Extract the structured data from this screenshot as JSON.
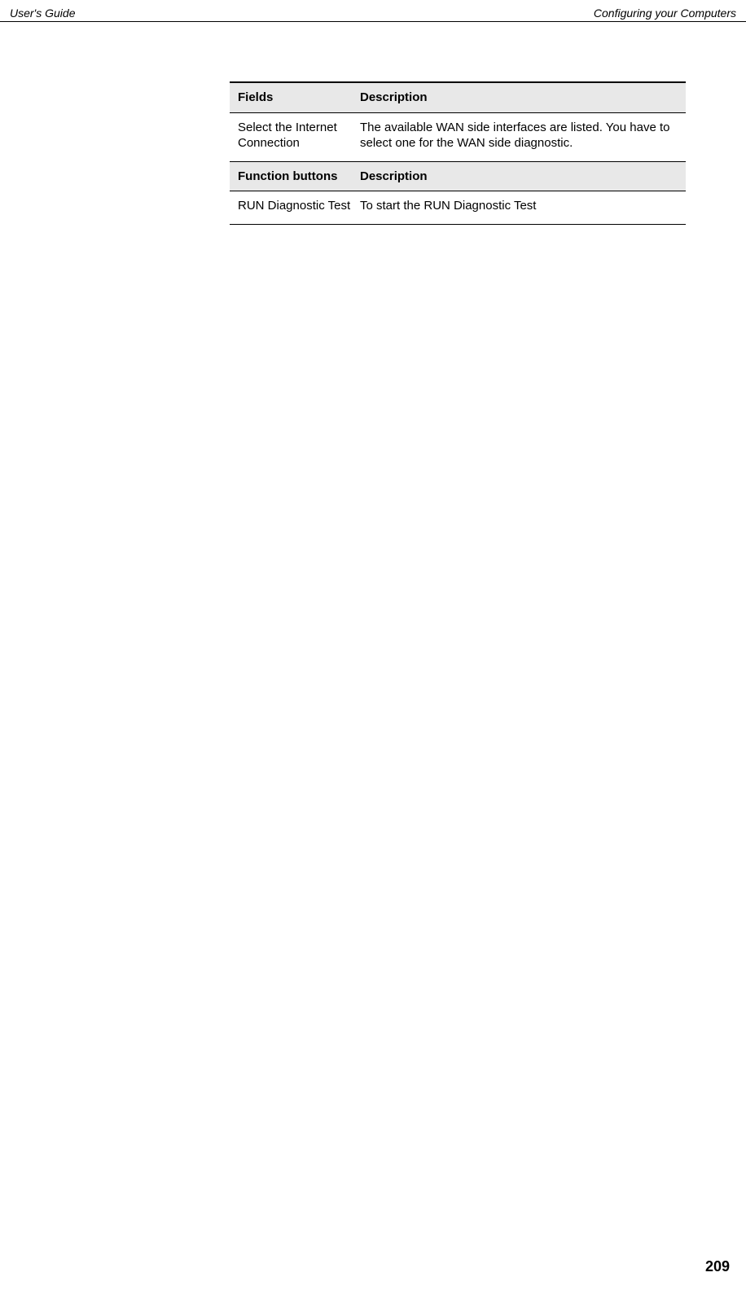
{
  "header": {
    "left": "User's Guide",
    "right": "Configuring your Computers"
  },
  "table": {
    "header1": {
      "col1": "Fields",
      "col2": "Description"
    },
    "row1": {
      "col1": "Select the Internet Connection",
      "col2": "The available WAN side interfaces are listed. You have to select one for the WAN side diagnostic."
    },
    "header2": {
      "col1": "Function buttons",
      "col2": "Description"
    },
    "row2": {
      "col1": "RUN Diagnostic Test",
      "col2": "To start the  RUN Diagnostic Test"
    }
  },
  "pageNumber": "209"
}
